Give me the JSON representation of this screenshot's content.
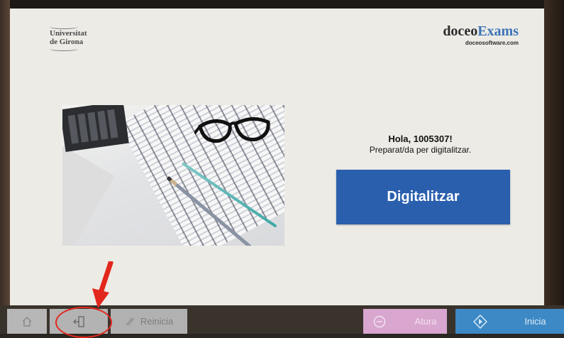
{
  "header": {
    "university_line1": "Universitat",
    "university_line2": "de Girona",
    "brand_part1": "doceo",
    "brand_part2": "Exams",
    "brand_url": "doceosoftware.com"
  },
  "main": {
    "greeting": "Hola, 1005307!",
    "status": "Preparat/da per digitalitzar.",
    "scan_button": "Digitalitzar"
  },
  "hardware_buttons": {
    "reset": "Reinicia",
    "stop": "Atura",
    "start": "Inicia"
  },
  "colors": {
    "scan_button": "#2a5fae",
    "brand_accent": "#3c74b6",
    "stop_button": "#d8a6cf",
    "start_button": "#3d89c5",
    "annotation": "#e3261c"
  },
  "icons": [
    "home-icon",
    "logout-icon",
    "pencil-icon",
    "stop-icon",
    "start-diamond-icon",
    "arrow-icon"
  ]
}
